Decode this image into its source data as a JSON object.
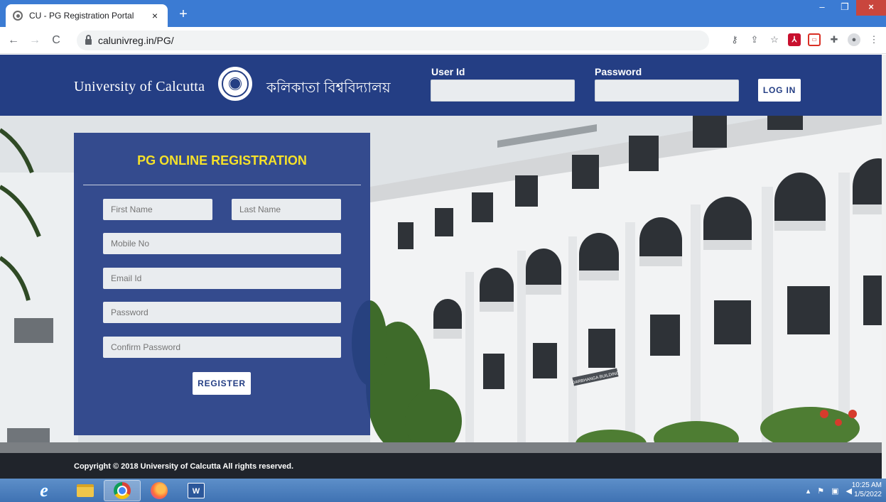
{
  "browser": {
    "tab_title": "CU - PG Registration Portal",
    "tab_close": "×",
    "new_tab": "+",
    "url": "calunivreg.in/PG/",
    "window": {
      "minimize": "–",
      "restore": "❐",
      "close": "×"
    },
    "nav": {
      "back": "←",
      "forward": "→",
      "reload": "C"
    }
  },
  "header": {
    "brand_en": "University of Calcutta",
    "brand_bn": "কলিকাতা বিশ্ববিদ্যালয়",
    "user_id_label": "User Id",
    "password_label": "Password",
    "user_id_value": "",
    "password_value": "",
    "login_label": "LOG IN"
  },
  "registration": {
    "title": "PG ONLINE REGISTRATION",
    "first_name_placeholder": "First Name",
    "last_name_placeholder": "Last Name",
    "mobile_placeholder": "Mobile No",
    "email_placeholder": "Email Id",
    "password_placeholder": "Password",
    "confirm_password_placeholder": "Confirm Password",
    "register_label": "REGISTER"
  },
  "hero": {
    "building_sign": "DARBHANGA BUILDING"
  },
  "footer": {
    "copyright": "Copyright © 2018 University of Calcutta All rights reserved."
  },
  "taskbar": {
    "time": "10:25 AM",
    "date": "1/5/2022",
    "ie_glyph": "e",
    "word_glyph": "W"
  }
}
